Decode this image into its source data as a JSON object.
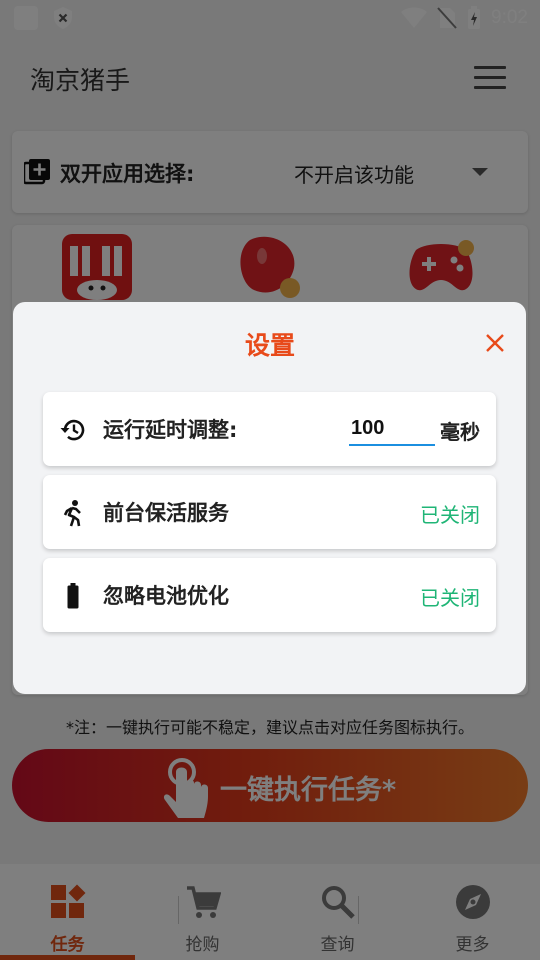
{
  "status_bar": {
    "time": "9:02"
  },
  "app": {
    "title": "淘京猪手"
  },
  "dual_app": {
    "label": "双开应用选择:",
    "selected": "不开启该功能"
  },
  "note": "*注：一键执行可能不稳定，建议点击对应任务图标执行。",
  "execute_button": {
    "label": "一键执行任务*"
  },
  "bottom_nav": [
    {
      "label": "任务",
      "icon": "grid-icon",
      "active": true
    },
    {
      "label": "抢购",
      "icon": "cart-icon",
      "active": false
    },
    {
      "label": "查询",
      "icon": "search-icon",
      "active": false
    },
    {
      "label": "更多",
      "icon": "compass-icon",
      "active": false
    }
  ],
  "dialog": {
    "title": "设置",
    "rows": [
      {
        "icon": "history-icon",
        "label": "运行延时调整:",
        "value": "100",
        "unit": "毫秒"
      },
      {
        "icon": "running-person-icon",
        "label": "前台保活服务",
        "status": "已关闭"
      },
      {
        "icon": "battery-icon",
        "label": "忽略电池优化",
        "status": "已关闭"
      }
    ]
  },
  "colors": {
    "accent": "#e84a1a",
    "status_off": "#1fb576",
    "input_underline": "#1b8fe0"
  }
}
